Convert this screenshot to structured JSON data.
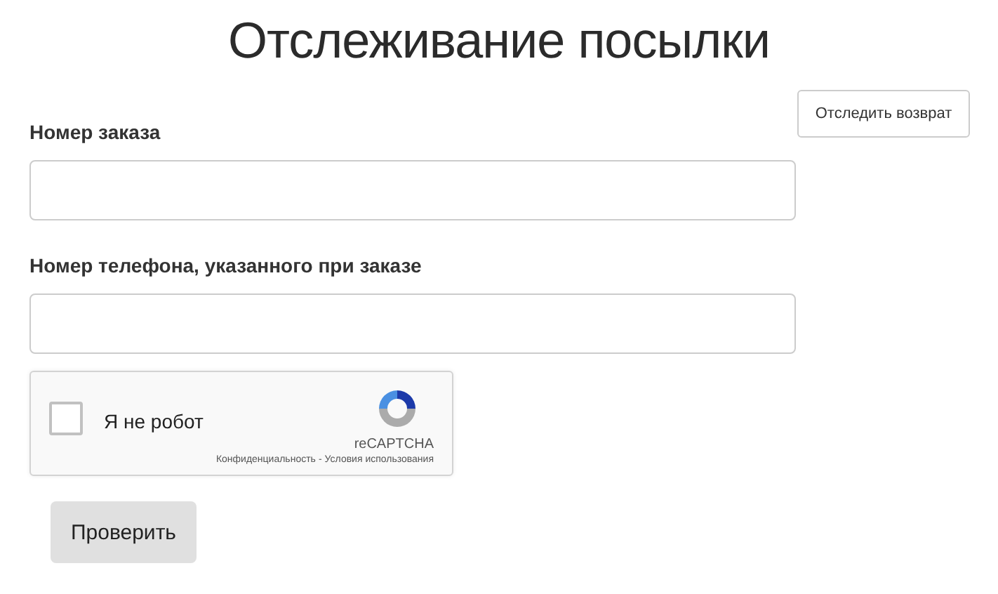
{
  "title": "Отслеживание посылки",
  "return_button": "Отследить возврат",
  "fields": [
    {
      "label": "Номер заказа"
    },
    {
      "label": "Номер телефона, указанного при заказе"
    }
  ],
  "captcha": {
    "label": "Я не робот",
    "checked": false,
    "brand": "reCAPTCHA",
    "privacy": "Конфиденциальность",
    "separator": "-",
    "terms": "Условия использования"
  },
  "submit": "Проверить"
}
